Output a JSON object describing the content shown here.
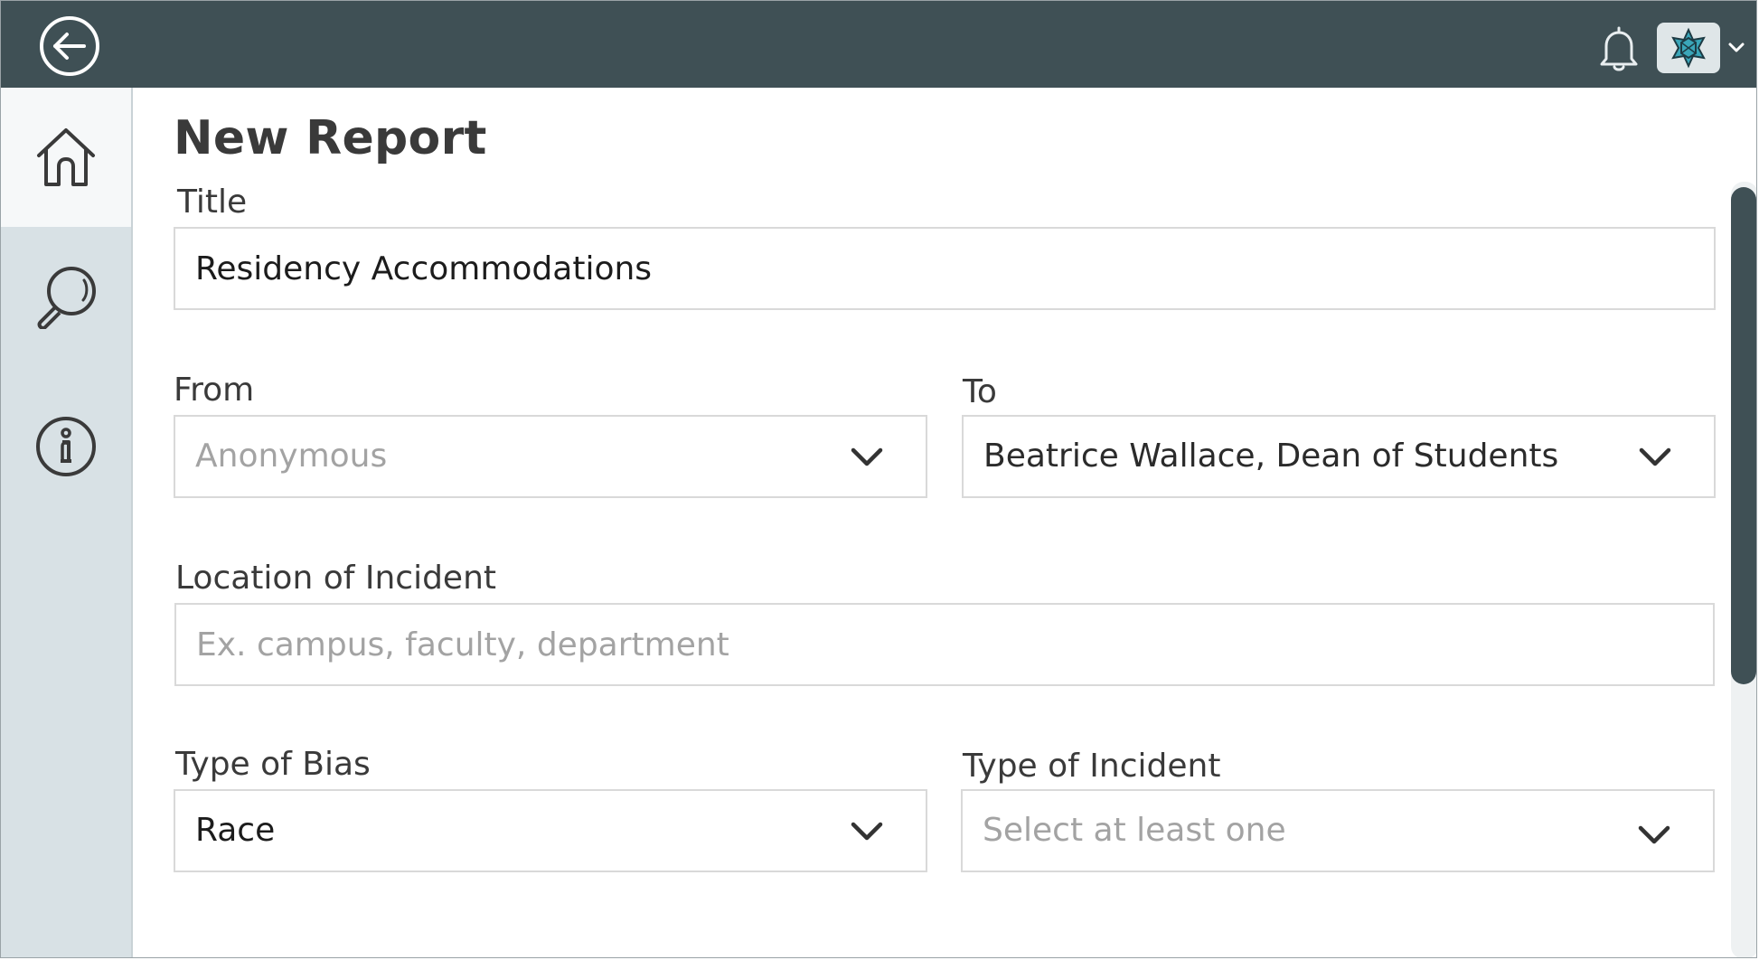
{
  "header": {
    "back_icon": "arrow-left-circle-icon",
    "bell_icon": "bell-icon",
    "avatar_icon": "star-emblem-icon",
    "caret_icon": "chevron-down-icon"
  },
  "sidebar": {
    "items": [
      {
        "name": "home",
        "icon": "home-icon",
        "active": true
      },
      {
        "name": "search",
        "icon": "search-icon",
        "active": false
      },
      {
        "name": "info",
        "icon": "info-icon",
        "active": false
      }
    ]
  },
  "form": {
    "page_title": "New Report",
    "title_label": "Title",
    "title_value": "Residency Accommodations",
    "from_label": "From",
    "from_value": "Anonymous",
    "to_label": "To",
    "to_value": "Beatrice Wallace, Dean of Students",
    "location_label": "Location of Incident",
    "location_placeholder": "Ex. campus, faculty, department",
    "bias_label": "Type of Bias",
    "bias_value": "Race",
    "incident_label": "Type of Incident",
    "incident_placeholder": "Select at least one"
  },
  "colors": {
    "header_bg": "#3f5055",
    "sidebar_bg": "#d8e1e5",
    "accent": "#3f5055",
    "placeholder": "#a3a3a3"
  }
}
